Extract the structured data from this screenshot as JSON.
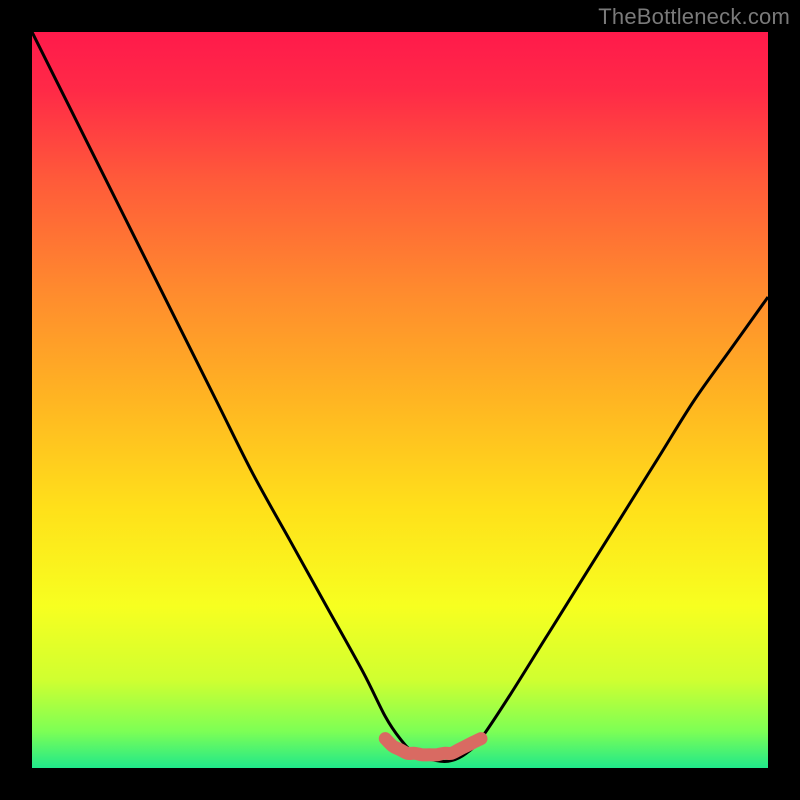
{
  "watermark": "TheBottleneck.com",
  "chart_data": {
    "type": "line",
    "title": "",
    "xlabel": "",
    "ylabel": "",
    "xlim": [
      0,
      100
    ],
    "ylim": [
      0,
      100
    ],
    "grid": false,
    "legend": false,
    "series": [
      {
        "name": "bottleneck-curve",
        "x": [
          0,
          5,
          10,
          15,
          20,
          25,
          30,
          35,
          40,
          45,
          48,
          50,
          52,
          55,
          57,
          59,
          61,
          65,
          70,
          75,
          80,
          85,
          90,
          95,
          100
        ],
        "y": [
          100,
          90,
          80,
          70,
          60,
          50,
          40,
          31,
          22,
          13,
          7,
          4,
          2,
          1,
          1,
          2,
          4,
          10,
          18,
          26,
          34,
          42,
          50,
          57,
          64
        ]
      },
      {
        "name": "optimal-marker",
        "x": [
          48,
          49,
          50,
          51,
          52,
          53,
          54,
          55,
          56,
          57,
          58,
          59,
          60,
          61
        ],
        "y": [
          4,
          3,
          2.5,
          2,
          2,
          1.8,
          1.8,
          1.8,
          2,
          2,
          2.5,
          3,
          3.5,
          4
        ]
      }
    ],
    "background_gradient": {
      "stops": [
        {
          "offset": 0.0,
          "color": "#ff1a4b"
        },
        {
          "offset": 0.08,
          "color": "#ff2a47"
        },
        {
          "offset": 0.2,
          "color": "#ff5a3a"
        },
        {
          "offset": 0.35,
          "color": "#ff8a2e"
        },
        {
          "offset": 0.5,
          "color": "#ffb522"
        },
        {
          "offset": 0.65,
          "color": "#ffe11a"
        },
        {
          "offset": 0.78,
          "color": "#f7ff20"
        },
        {
          "offset": 0.88,
          "color": "#d0ff30"
        },
        {
          "offset": 0.95,
          "color": "#7dff55"
        },
        {
          "offset": 1.0,
          "color": "#20e88a"
        }
      ]
    },
    "marker_color": "#d96a62",
    "curve_color": "#000000"
  }
}
